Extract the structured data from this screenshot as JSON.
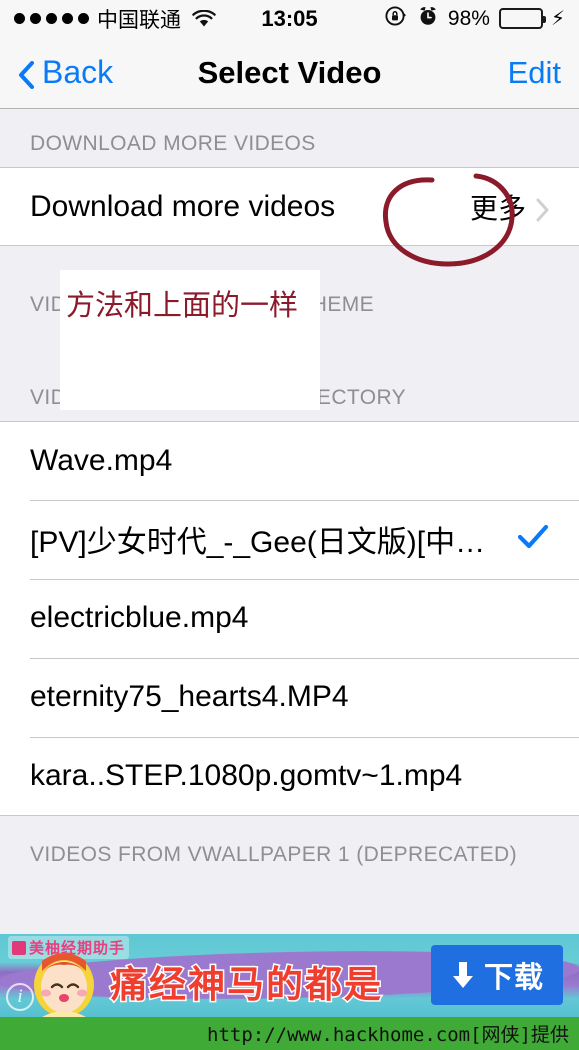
{
  "status_bar": {
    "signal_dots": 5,
    "carrier": "中国联通",
    "wifi_icon": "wifi-icon",
    "time": "13:05",
    "rotation_lock_icon": "rotation-lock-icon",
    "alarm_icon": "alarm-clock-icon",
    "battery_percent": "98%",
    "battery_level": 98,
    "charging_icon": "lightning-bolt-icon"
  },
  "navbar": {
    "back_label": "Back",
    "back_icon": "chevron-left-icon",
    "title": "Select Video",
    "edit_label": "Edit"
  },
  "sections": [
    {
      "header": "DOWNLOAD MORE VIDEOS",
      "rows": [
        {
          "label": "Download more videos",
          "sub_label": "更多",
          "accessory": "chevron-right-icon",
          "checked": false
        }
      ]
    },
    {
      "header": "VIDEOS FROM CURRENT THEME",
      "header_visible_fragments": [
        "VID",
        "T THEME"
      ],
      "rows": []
    },
    {
      "header": "VIDEOS FROM GLOBAL DIRECTORY",
      "rows": [
        {
          "label": "Wave.mp4",
          "checked": false
        },
        {
          "label": "[PV]少女时代_-_Gee(日文版)[中…",
          "checked": true
        },
        {
          "label": "electricblue.mp4",
          "checked": false
        },
        {
          "label": "eternity75_hearts4.MP4",
          "checked": false
        },
        {
          "label": "kara..STEP.1080p.gomtv~1.mp4",
          "checked": false
        }
      ]
    },
    {
      "header": "VIDEOS FROM VWALLPAPER 1 (DEPRECATED)",
      "rows": []
    }
  ],
  "annotations": {
    "circle_target": "更多",
    "note_text": "方法和上面的一样",
    "ink_color": "#8b1a2b"
  },
  "ad": {
    "brand": "美柚经期助手",
    "headline": "痛经神马的都是",
    "info_icon": "info-icon",
    "download_icon": "download-arrow-icon",
    "download_label": "下载",
    "button_color": "#1f6fe0"
  },
  "footer": {
    "watermark": "http://www.hackhome.com[网侠]提供",
    "background_color": "#3faa35"
  },
  "colors": {
    "tint_blue": "#0a7bf7",
    "group_background": "#efeff4",
    "cell_background": "#ffffff",
    "separator": "#c8c7cc",
    "section_header_text": "#8e8e93",
    "checkmark": "#0a7bf7"
  }
}
